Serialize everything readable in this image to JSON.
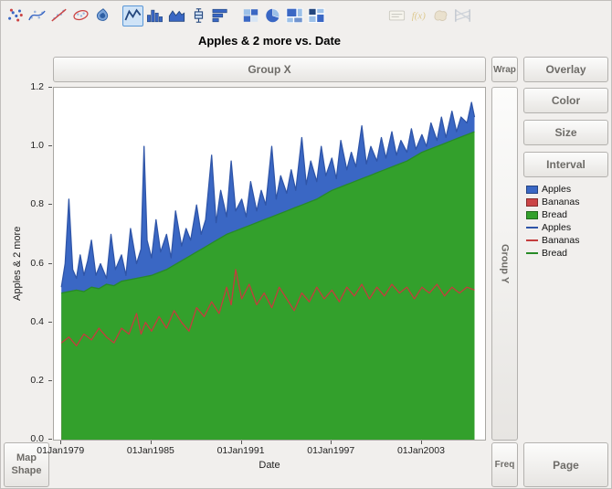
{
  "title": "Apples & 2 more vs. Date",
  "toolbar": {
    "icons": [
      {
        "name": "points",
        "selected": false,
        "disabled": false
      },
      {
        "name": "smoother",
        "selected": false,
        "disabled": false
      },
      {
        "name": "line-of-fit",
        "selected": false,
        "disabled": false
      },
      {
        "name": "ellipse",
        "selected": false,
        "disabled": false
      },
      {
        "name": "contour",
        "selected": false,
        "disabled": false
      },
      {
        "name": "line",
        "selected": true,
        "disabled": false
      },
      {
        "name": "bar",
        "selected": false,
        "disabled": false
      },
      {
        "name": "area",
        "selected": false,
        "disabled": false
      },
      {
        "name": "box-plot",
        "selected": false,
        "disabled": false
      },
      {
        "name": "histogram",
        "selected": false,
        "disabled": false
      },
      {
        "name": "heatmap",
        "selected": false,
        "disabled": false
      },
      {
        "name": "pie",
        "selected": false,
        "disabled": false
      },
      {
        "name": "treemap",
        "selected": false,
        "disabled": false
      },
      {
        "name": "mosaic",
        "selected": false,
        "disabled": false
      },
      {
        "name": "caption-box",
        "selected": false,
        "disabled": true
      },
      {
        "name": "formula",
        "selected": false,
        "disabled": true
      },
      {
        "name": "map-shapes",
        "selected": false,
        "disabled": true
      },
      {
        "name": "parallel",
        "selected": false,
        "disabled": true
      }
    ]
  },
  "drop_zones": {
    "group_x": "Group X",
    "wrap": "Wrap",
    "overlay": "Overlay",
    "color": "Color",
    "size": "Size",
    "interval": "Interval",
    "group_y": "Group Y",
    "map_shape": "Map Shape",
    "freq": "Freq",
    "page": "Page"
  },
  "legend": {
    "entries": [
      {
        "label": "Apples",
        "color": "#3a67c4",
        "swatch": "fill"
      },
      {
        "label": "Bananas",
        "color": "#cb4446",
        "swatch": "fill"
      },
      {
        "label": "Bread",
        "color": "#33a02c",
        "swatch": "fill"
      },
      {
        "label": "Apples",
        "color": "#2f55a8",
        "swatch": "line"
      },
      {
        "label": "Bananas",
        "color": "#c43d3d",
        "swatch": "line"
      },
      {
        "label": "Bread",
        "color": "#278a27",
        "swatch": "line"
      }
    ]
  },
  "chart_data": {
    "type": "area",
    "title": "Apples & 2 more vs. Date",
    "xlabel": "Date",
    "ylabel": "Apples & 2 more",
    "x_domain": [
      1978.5,
      2007.2
    ],
    "ylim": [
      0,
      1.2
    ],
    "grid": false,
    "legend_position": "right",
    "yticks": [
      {
        "v": 0,
        "label": "0.0"
      },
      {
        "v": 0.2,
        "label": "0.2"
      },
      {
        "v": 0.4,
        "label": "0.4"
      },
      {
        "v": 0.6,
        "label": "0.6"
      },
      {
        "v": 0.8,
        "label": "0.8"
      },
      {
        "v": 1.0,
        "label": "1.0"
      },
      {
        "v": 1.2,
        "label": "1.2"
      }
    ],
    "xticks": [
      {
        "v": 1979,
        "label": "01Jan1979"
      },
      {
        "v": 1985,
        "label": "01Jan1985"
      },
      {
        "v": 1991,
        "label": "01Jan1991"
      },
      {
        "v": 1997,
        "label": "01Jan1997"
      },
      {
        "v": 2003,
        "label": "01Jan2003"
      }
    ],
    "series": [
      {
        "name": "Apples",
        "area": true,
        "color": "#3a67c4",
        "line_color": "#2f55a8",
        "x": [
          1979.0,
          1979.25,
          1979.5,
          1979.75,
          1980.0,
          1980.25,
          1980.5,
          1980.75,
          1981.0,
          1981.3,
          1981.6,
          1982.0,
          1982.3,
          1982.6,
          1983.0,
          1983.3,
          1983.6,
          1984.0,
          1984.3,
          1984.5,
          1984.7,
          1985.0,
          1985.3,
          1985.6,
          1986.0,
          1986.3,
          1986.6,
          1987.0,
          1987.3,
          1987.6,
          1988.0,
          1988.3,
          1988.6,
          1989.0,
          1989.3,
          1989.6,
          1990.0,
          1990.3,
          1990.6,
          1991.0,
          1991.3,
          1991.6,
          1992.0,
          1992.3,
          1992.6,
          1993.0,
          1993.3,
          1993.6,
          1994.0,
          1994.3,
          1994.6,
          1995.0,
          1995.3,
          1995.6,
          1996.0,
          1996.3,
          1996.6,
          1997.0,
          1997.3,
          1997.6,
          1998.0,
          1998.3,
          1998.6,
          1999.0,
          1999.3,
          1999.6,
          2000.0,
          2000.3,
          2000.6,
          2001.0,
          2001.3,
          2001.6,
          2002.0,
          2002.3,
          2002.6,
          2003.0,
          2003.3,
          2003.6,
          2004.0,
          2004.3,
          2004.6,
          2005.0,
          2005.3,
          2005.6,
          2006.0,
          2006.3,
          2006.5
        ],
        "y": [
          0.52,
          0.6,
          0.82,
          0.58,
          0.55,
          0.63,
          0.56,
          0.61,
          0.68,
          0.56,
          0.6,
          0.55,
          0.7,
          0.58,
          0.63,
          0.56,
          0.72,
          0.6,
          0.65,
          1.0,
          0.68,
          0.62,
          0.75,
          0.64,
          0.7,
          0.62,
          0.78,
          0.66,
          0.72,
          0.68,
          0.8,
          0.7,
          0.75,
          0.97,
          0.74,
          0.85,
          0.76,
          0.95,
          0.78,
          0.82,
          0.76,
          0.88,
          0.78,
          0.85,
          0.8,
          1.0,
          0.82,
          0.9,
          0.84,
          0.92,
          0.85,
          1.03,
          0.87,
          0.95,
          0.88,
          1.0,
          0.9,
          0.96,
          0.89,
          1.02,
          0.92,
          0.98,
          0.93,
          1.07,
          0.94,
          1.0,
          0.95,
          1.03,
          0.96,
          1.05,
          0.97,
          1.02,
          0.98,
          1.06,
          0.99,
          1.04,
          1.0,
          1.08,
          1.02,
          1.1,
          1.03,
          1.12,
          1.05,
          1.1,
          1.08,
          1.15,
          1.1
        ]
      },
      {
        "name": "Bananas",
        "area": true,
        "color": "#cb4446",
        "line_color": "#c43d3d",
        "x": [
          1979.0,
          1979.5,
          1980.0,
          1980.5,
          1981.0,
          1981.5,
          1982.0,
          1982.5,
          1983.0,
          1983.5,
          1984.0,
          1984.3,
          1984.6,
          1985.0,
          1985.5,
          1986.0,
          1986.5,
          1987.0,
          1987.5,
          1988.0,
          1988.5,
          1989.0,
          1989.5,
          1990.0,
          1990.3,
          1990.6,
          1991.0,
          1991.5,
          1992.0,
          1992.5,
          1993.0,
          1993.5,
          1994.0,
          1994.5,
          1995.0,
          1995.5,
          1996.0,
          1996.5,
          1997.0,
          1997.5,
          1998.0,
          1998.5,
          1999.0,
          1999.5,
          2000.0,
          2000.5,
          2001.0,
          2001.5,
          2002.0,
          2002.5,
          2003.0,
          2003.5,
          2004.0,
          2004.5,
          2005.0,
          2005.5,
          2006.0,
          2006.5
        ],
        "y": [
          0.33,
          0.35,
          0.32,
          0.36,
          0.34,
          0.38,
          0.35,
          0.33,
          0.38,
          0.36,
          0.43,
          0.36,
          0.4,
          0.37,
          0.42,
          0.38,
          0.44,
          0.4,
          0.37,
          0.45,
          0.42,
          0.47,
          0.43,
          0.52,
          0.46,
          0.58,
          0.48,
          0.53,
          0.46,
          0.5,
          0.45,
          0.52,
          0.48,
          0.44,
          0.5,
          0.47,
          0.52,
          0.48,
          0.51,
          0.47,
          0.52,
          0.49,
          0.53,
          0.48,
          0.52,
          0.49,
          0.53,
          0.5,
          0.52,
          0.48,
          0.52,
          0.5,
          0.53,
          0.49,
          0.52,
          0.5,
          0.52,
          0.51
        ]
      },
      {
        "name": "Bread",
        "area": true,
        "color": "#33a02c",
        "line_color": "#278a27",
        "x": [
          1979.0,
          1979.5,
          1980.0,
          1980.5,
          1981.0,
          1981.5,
          1982.0,
          1982.5,
          1983.0,
          1983.5,
          1984.0,
          1984.5,
          1985.0,
          1985.5,
          1986.0,
          1986.5,
          1987.0,
          1987.5,
          1988.0,
          1988.5,
          1989.0,
          1989.5,
          1990.0,
          1990.5,
          1991.0,
          1991.5,
          1992.0,
          1992.5,
          1993.0,
          1993.5,
          1994.0,
          1994.5,
          1995.0,
          1995.5,
          1996.0,
          1996.5,
          1997.0,
          1997.5,
          1998.0,
          1998.5,
          1999.0,
          1999.5,
          2000.0,
          2000.5,
          2001.0,
          2001.5,
          2002.0,
          2002.5,
          2003.0,
          2003.5,
          2004.0,
          2004.5,
          2005.0,
          2005.5,
          2006.0,
          2006.5
        ],
        "y": [
          0.5,
          0.505,
          0.51,
          0.505,
          0.52,
          0.515,
          0.53,
          0.525,
          0.54,
          0.545,
          0.55,
          0.555,
          0.56,
          0.57,
          0.58,
          0.595,
          0.61,
          0.625,
          0.64,
          0.655,
          0.67,
          0.685,
          0.7,
          0.71,
          0.72,
          0.73,
          0.74,
          0.75,
          0.76,
          0.77,
          0.78,
          0.79,
          0.8,
          0.81,
          0.82,
          0.835,
          0.85,
          0.86,
          0.87,
          0.88,
          0.89,
          0.9,
          0.91,
          0.92,
          0.93,
          0.94,
          0.95,
          0.965,
          0.98,
          0.99,
          1.0,
          1.01,
          1.02,
          1.03,
          1.04,
          1.05
        ]
      }
    ]
  }
}
